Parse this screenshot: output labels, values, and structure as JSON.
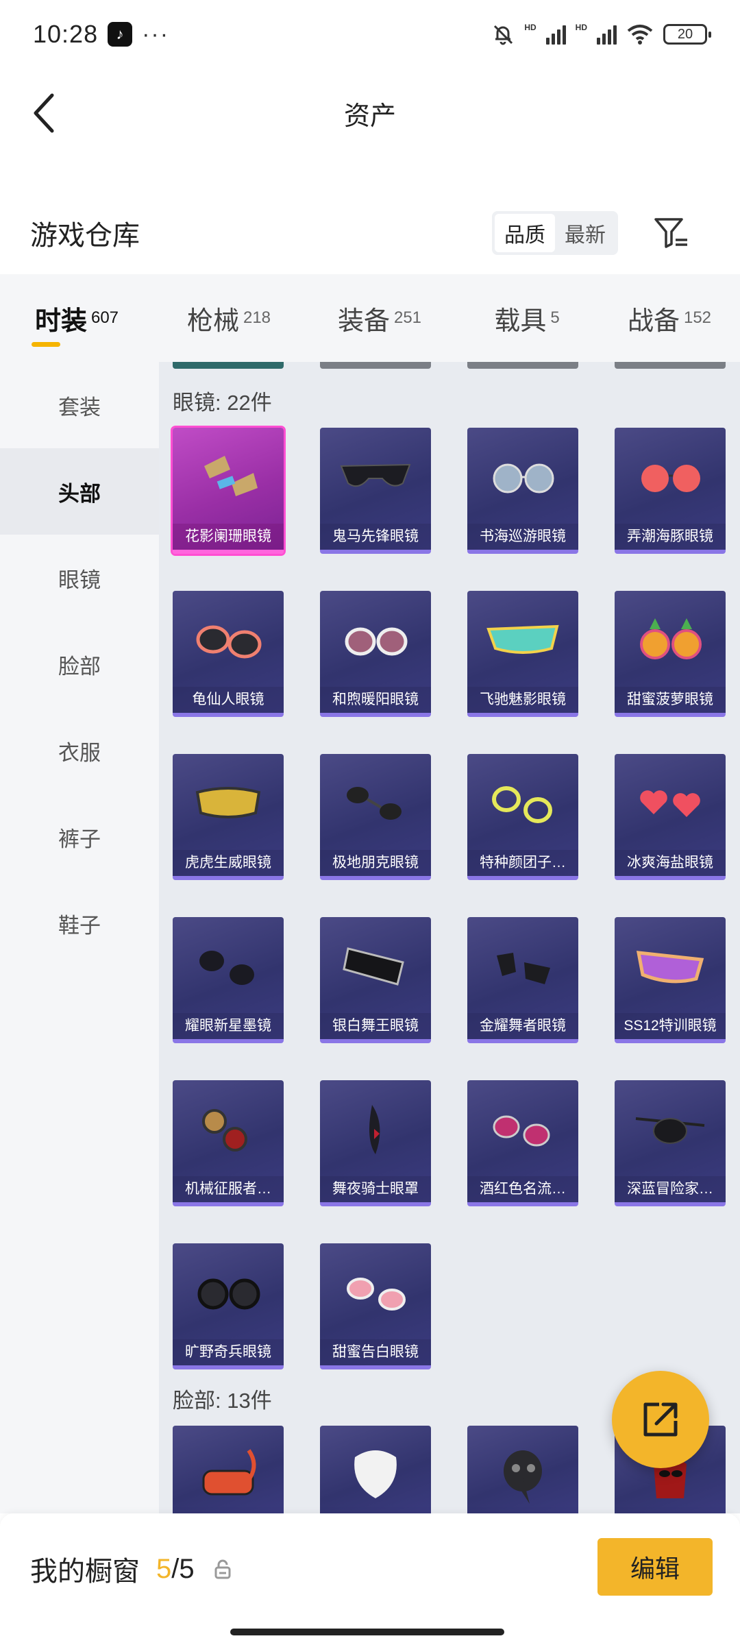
{
  "status": {
    "time": "10:28",
    "dots": "···",
    "hd1": "HD",
    "hd2": "HD",
    "battery": "20"
  },
  "header": {
    "title": "资产"
  },
  "warehouse": {
    "title": "游戏仓库",
    "sort_quality": "品质",
    "sort_newest": "最新"
  },
  "categories": [
    {
      "label": "时装",
      "count": "607",
      "active": true
    },
    {
      "label": "枪械",
      "count": "218"
    },
    {
      "label": "装备",
      "count": "251"
    },
    {
      "label": "载具",
      "count": "5"
    },
    {
      "label": "战备",
      "count": "152"
    }
  ],
  "sidebar": [
    {
      "label": "套装"
    },
    {
      "label": "头部",
      "active": true
    },
    {
      "label": "眼镜"
    },
    {
      "label": "脸部"
    },
    {
      "label": "衣服"
    },
    {
      "label": "裤子"
    },
    {
      "label": "鞋子"
    }
  ],
  "sections": {
    "glasses": {
      "header": "眼镜: 22件",
      "items": [
        {
          "name": "花影阑珊眼镜",
          "rarity": "pink"
        },
        {
          "name": "鬼马先锋眼镜"
        },
        {
          "name": "书海巡游眼镜"
        },
        {
          "name": "弄潮海豚眼镜"
        },
        {
          "name": "龟仙人眼镜"
        },
        {
          "name": "和煦暖阳眼镜"
        },
        {
          "name": "飞驰魅影眼镜"
        },
        {
          "name": "甜蜜菠萝眼镜"
        },
        {
          "name": "虎虎生威眼镜"
        },
        {
          "name": "极地朋克眼镜"
        },
        {
          "name": "特种颜团子…"
        },
        {
          "name": "冰爽海盐眼镜"
        },
        {
          "name": "耀眼新星墨镜"
        },
        {
          "name": "银白舞王眼镜"
        },
        {
          "name": "金耀舞者眼镜"
        },
        {
          "name": "SS12特训眼镜"
        },
        {
          "name": "机械征服者…"
        },
        {
          "name": "舞夜骑士眼罩"
        },
        {
          "name": "酒红色名流…"
        },
        {
          "name": "深蓝冒险家…"
        },
        {
          "name": "旷野奇兵眼镜"
        },
        {
          "name": "甜蜜告白眼镜"
        }
      ]
    },
    "face": {
      "header": "脸部: 13件"
    }
  },
  "showcase": {
    "label": "我的橱窗",
    "current": "5",
    "sep": "/",
    "max": "5"
  },
  "edit_label": "编辑",
  "colors": {
    "accent": "#f3b52a",
    "card_bg": "#3a3a7a",
    "rare_pink": "#c04cc6"
  }
}
